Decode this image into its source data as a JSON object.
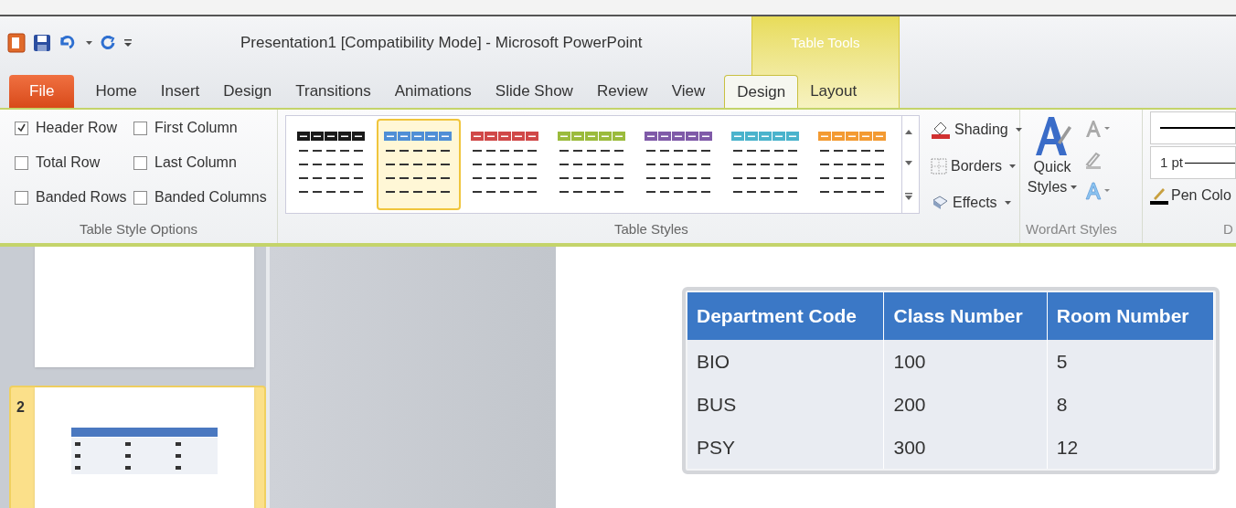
{
  "title_bar": {
    "title": "Presentation1 [Compatibility Mode]  -  Microsoft PowerPoint"
  },
  "contextual_group": {
    "label": "Table Tools"
  },
  "tabs": [
    {
      "label": "File",
      "kind": "file",
      "selected": false
    },
    {
      "label": "Home",
      "kind": "normal",
      "selected": false
    },
    {
      "label": "Insert",
      "kind": "normal",
      "selected": false
    },
    {
      "label": "Design",
      "kind": "normal",
      "selected": false
    },
    {
      "label": "Transitions",
      "kind": "normal",
      "selected": false
    },
    {
      "label": "Animations",
      "kind": "normal",
      "selected": false
    },
    {
      "label": "Slide Show",
      "kind": "normal",
      "selected": false
    },
    {
      "label": "Review",
      "kind": "normal",
      "selected": false
    },
    {
      "label": "View",
      "kind": "normal",
      "selected": false
    },
    {
      "label": "Design",
      "kind": "contextual",
      "selected": true
    },
    {
      "label": "Layout",
      "kind": "contextual",
      "selected": false
    }
  ],
  "table_style_options": {
    "label": "Table Style Options",
    "checkboxes": [
      {
        "label": "Header Row",
        "checked": true
      },
      {
        "label": "First Column",
        "checked": false
      },
      {
        "label": "Total Row",
        "checked": false
      },
      {
        "label": "Last Column",
        "checked": false
      },
      {
        "label": "Banded Rows",
        "checked": false
      },
      {
        "label": "Banded Columns",
        "checked": false
      }
    ]
  },
  "table_styles": {
    "label": "Table Styles",
    "swatches": [
      {
        "color": "#1a1a1a",
        "selected": false
      },
      {
        "color": "#4f8fd6",
        "selected": true
      },
      {
        "color": "#d04848",
        "selected": false
      },
      {
        "color": "#9bbb3c",
        "selected": false
      },
      {
        "color": "#7f5aa8",
        "selected": false
      },
      {
        "color": "#4ab3cc",
        "selected": false
      },
      {
        "color": "#f39a32",
        "selected": false
      }
    ],
    "commands": [
      {
        "label": "Shading",
        "kind": "shading"
      },
      {
        "label": "Borders",
        "kind": "borders"
      },
      {
        "label": "Effects",
        "kind": "effects"
      }
    ]
  },
  "wordart_styles": {
    "label": "WordArt Styles",
    "quick_styles": "Quick Styles"
  },
  "draw_borders": {
    "weight": "1 pt",
    "pen_color": "Pen Colo",
    "label": "D"
  },
  "thumbnails": [
    {
      "selected": false
    },
    {
      "number": "2",
      "selected": true
    }
  ],
  "table": {
    "columns": [
      "Department Code",
      "Class Number",
      "Room Number"
    ],
    "rows": [
      [
        "BIO",
        "100",
        "5"
      ],
      [
        "BUS",
        "200",
        "8"
      ],
      [
        "PSY",
        "300",
        "12"
      ]
    ]
  }
}
